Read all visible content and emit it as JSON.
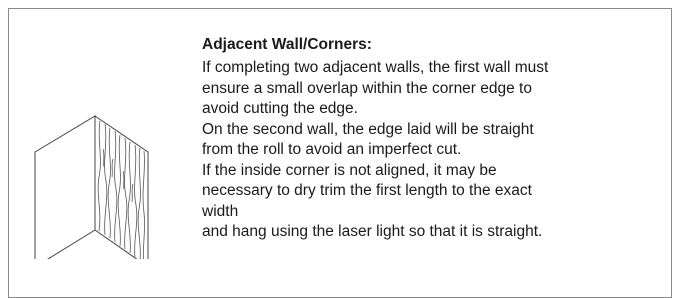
{
  "section": {
    "heading": "Adjacent Wall/Corners:",
    "lines": [
      "If completing two adjacent walls, the first wall must",
      "ensure a small overlap within the corner edge to",
      "avoid cutting the edge.",
      "On the second wall, the edge laid will be straight",
      "from the roll to avoid an imperfect cut.",
      "If the inside corner is not aligned, it may be",
      "necessary to dry trim the first length to the exact",
      "width",
      "and hang using the laser light so that it is straight."
    ]
  },
  "illustration": {
    "icon": "corner-wallpaper-icon",
    "stroke_color": "#444444"
  }
}
